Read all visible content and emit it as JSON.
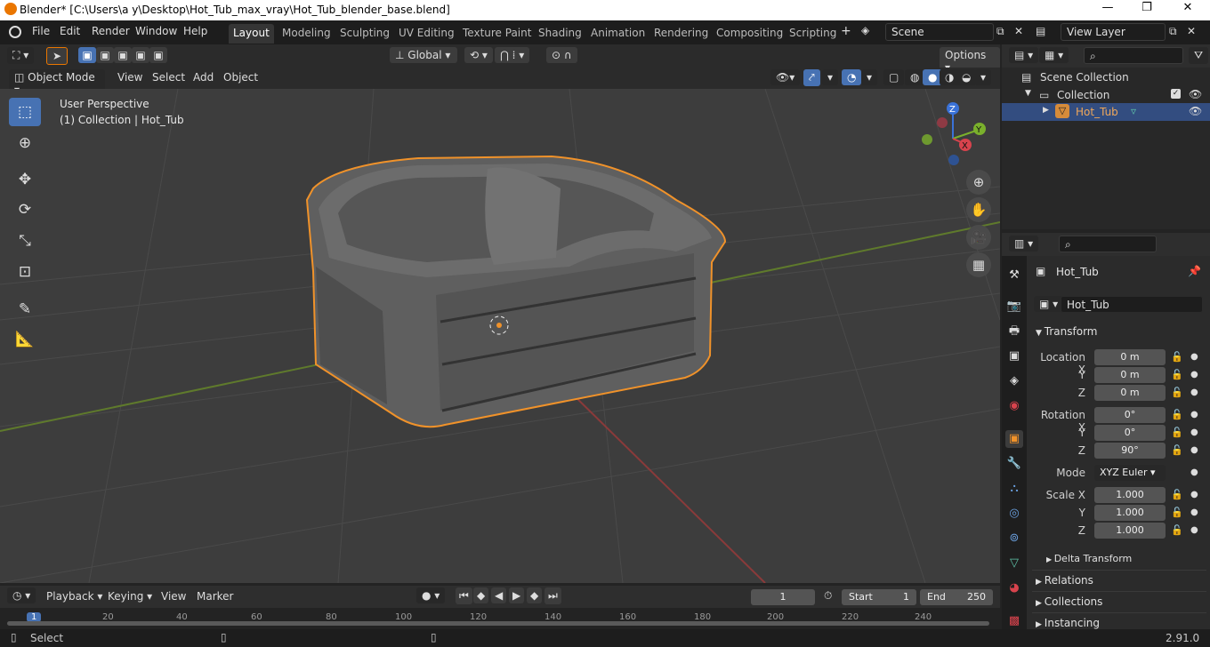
{
  "window": {
    "title": "Blender* [C:\\Users\\a y\\Desktop\\Hot_Tub_max_vray\\Hot_Tub_blender_base.blend]"
  },
  "menu": [
    "File",
    "Edit",
    "Render",
    "Window",
    "Help"
  ],
  "workspaces": [
    "Layout",
    "Modeling",
    "Sculpting",
    "UV Editing",
    "Texture Paint",
    "Shading",
    "Animation",
    "Rendering",
    "Compositing",
    "Scripting"
  ],
  "scene": {
    "name": "Scene",
    "view_layer": "View Layer"
  },
  "viewport": {
    "transform_orientation": "Global",
    "options_label": "Options",
    "mode": "Object Mode",
    "menus": [
      "View",
      "Select",
      "Add",
      "Object"
    ],
    "overlay_title": "User Perspective",
    "overlay_subtitle": "(1) Collection | Hot_Tub",
    "gizmo": {
      "z": "Z",
      "y": "Y",
      "x": "X"
    }
  },
  "outliner": {
    "scene_collection": "Scene Collection",
    "collection": "Collection",
    "object": "Hot_Tub"
  },
  "properties": {
    "object_name": "Hot_Tub",
    "data_name": "Hot_Tub",
    "transform_label": "Transform",
    "location": {
      "label": "Location X",
      "x": "0 m",
      "y": "0 m",
      "z": "0 m"
    },
    "rotation": {
      "label": "Rotation X",
      "x": "0°",
      "y": "0°",
      "z": "90°"
    },
    "mode_label": "Mode",
    "mode_value": "XYZ Euler",
    "scale": {
      "label": "Scale X",
      "x": "1.000",
      "y": "1.000",
      "z": "1.000"
    },
    "axis_y": "Y",
    "axis_z": "Z",
    "delta_transform": "Delta Transform",
    "relations": "Relations",
    "collections": "Collections",
    "instancing": "Instancing"
  },
  "timeline": {
    "menus": [
      "Playback",
      "Keying",
      "View",
      "Marker"
    ],
    "current_frame": "1",
    "start_label": "Start",
    "start": "1",
    "end_label": "End",
    "end": "250",
    "ticks": [
      "1",
      "20",
      "40",
      "60",
      "80",
      "100",
      "120",
      "140",
      "160",
      "180",
      "200",
      "220",
      "240"
    ]
  },
  "status": {
    "left": "Select",
    "version": "2.91.0"
  }
}
